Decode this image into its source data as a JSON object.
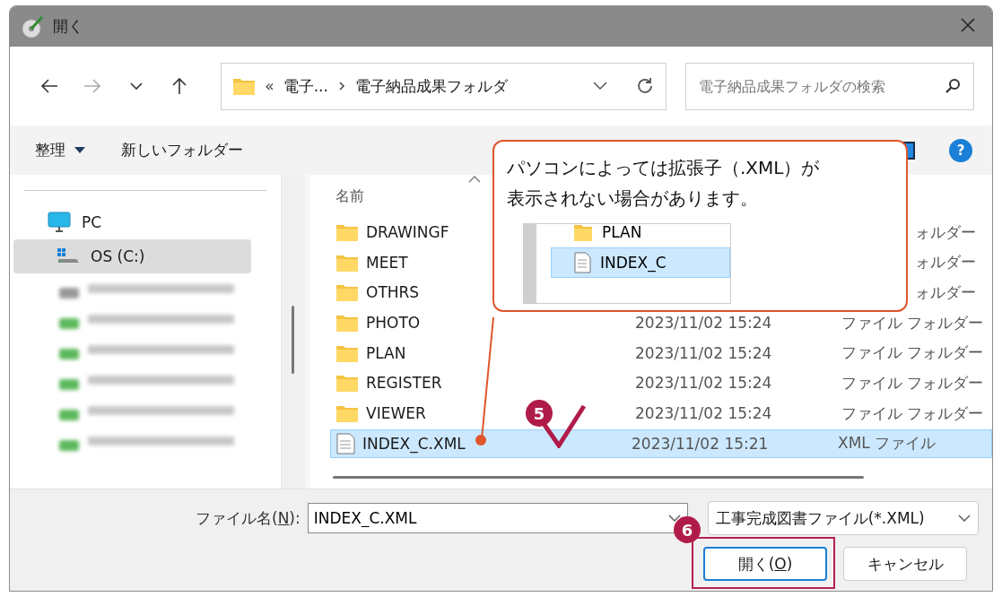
{
  "window": {
    "title": "開く"
  },
  "nav": {
    "buttons": [
      {
        "kind": "back",
        "disabled": false
      },
      {
        "kind": "forward",
        "disabled": true
      },
      {
        "kind": "recent",
        "disabled": false
      },
      {
        "kind": "up",
        "disabled": false
      }
    ]
  },
  "address": {
    "overflow_marker": "«",
    "segments": [
      "電子...",
      "電子納品成果フォルダ"
    ]
  },
  "search": {
    "placeholder": "電子納品成果フォルダの検索"
  },
  "command_bar": {
    "organize": "整理",
    "new_folder": "新しいフォルダー",
    "help": "?"
  },
  "sidebar": {
    "items": [
      {
        "kind": "pc",
        "label": "PC",
        "selected": false
      },
      {
        "kind": "drive",
        "label": "OS (C:)",
        "selected": true
      },
      {
        "kind": "blurred",
        "selected": false
      },
      {
        "kind": "blurred",
        "selected": false
      },
      {
        "kind": "blurred",
        "selected": false
      },
      {
        "kind": "blurred",
        "selected": false
      },
      {
        "kind": "blurred",
        "selected": false
      },
      {
        "kind": "blurred",
        "selected": false
      }
    ]
  },
  "file_list": {
    "columns": [
      "名前"
    ],
    "sort_ascending": true,
    "rows": [
      {
        "kind": "folder",
        "name": "DRAWINGF",
        "type": "ォルダー",
        "selected": false
      },
      {
        "kind": "folder",
        "name": "MEET",
        "type": "ォルダー",
        "selected": false
      },
      {
        "kind": "folder",
        "name": "OTHRS",
        "type": "ォルダー",
        "selected": false
      },
      {
        "kind": "folder",
        "name": "PHOTO",
        "date": "2023/11/02 15:24",
        "type": "ファイル フォルダー",
        "selected": false
      },
      {
        "kind": "folder",
        "name": "PLAN",
        "date": "2023/11/02 15:24",
        "type": "ファイル フォルダー",
        "selected": false
      },
      {
        "kind": "folder",
        "name": "REGISTER",
        "date": "2023/11/02 15:24",
        "type": "ファイル フォルダー",
        "selected": false
      },
      {
        "kind": "folder",
        "name": "VIEWER",
        "date": "2023/11/02 15:24",
        "type": "ファイル フォルダー",
        "selected": false
      },
      {
        "kind": "file",
        "name": "INDEX_C.XML",
        "date": "2023/11/02 15:21",
        "type": "XML ファイル",
        "selected": true
      }
    ]
  },
  "footer": {
    "filename_label": {
      "before": "ファイル名(",
      "key": "N",
      "after": "):"
    },
    "filename": "INDEX_C.XML",
    "filter": "工事完成図書ファイル(*.XML)",
    "buttons": [
      {
        "kind": "open",
        "before": "開く(",
        "key": "O",
        "after": ")"
      },
      {
        "kind": "cancel",
        "before": "キャンセル"
      }
    ]
  },
  "callout": {
    "text": "パソコンによっては拡張子（.XML）が表示されない場合があります。",
    "preview": [
      {
        "kind": "folder",
        "name": "PLAN",
        "selected": false
      },
      {
        "kind": "file",
        "name": "INDEX_C",
        "selected": true
      }
    ]
  },
  "steps": [
    {
      "number": "5"
    },
    {
      "number": "6"
    }
  ]
}
